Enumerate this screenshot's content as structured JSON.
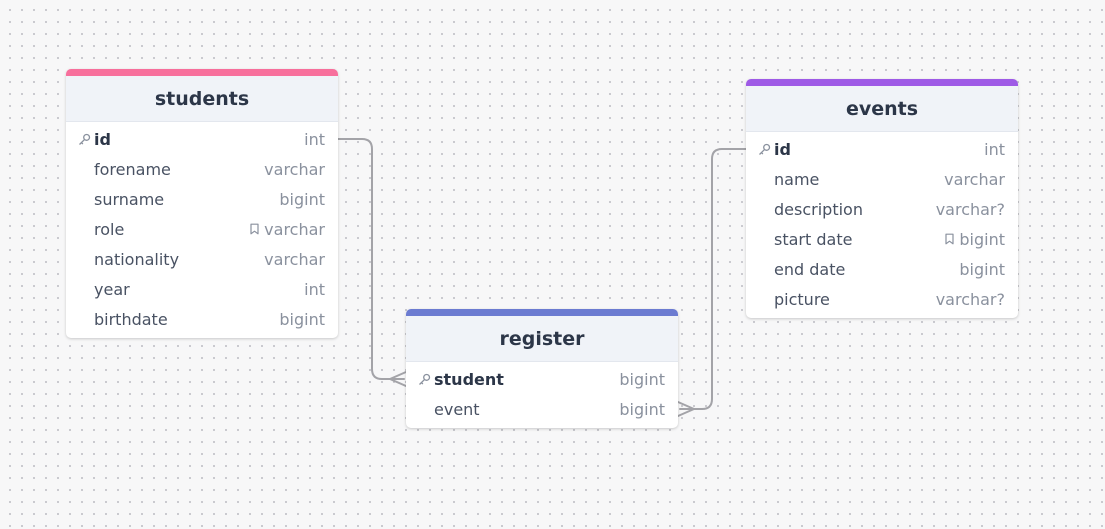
{
  "colors": {
    "students_accent": "#f76f9c",
    "events_accent": "#9e5ae6",
    "register_accent": "#6b7bd1",
    "connector": "#a3a3a8"
  },
  "tables": {
    "students": {
      "title": "students",
      "columns": [
        {
          "name": "id",
          "type": "int",
          "pk": true
        },
        {
          "name": "forename",
          "type": "varchar"
        },
        {
          "name": "surname",
          "type": "bigint"
        },
        {
          "name": "role",
          "type": "varchar",
          "note": true
        },
        {
          "name": "nationality",
          "type": "varchar"
        },
        {
          "name": "year",
          "type": "int"
        },
        {
          "name": "birthdate",
          "type": "bigint"
        }
      ]
    },
    "events": {
      "title": "events",
      "columns": [
        {
          "name": "id",
          "type": "int",
          "pk": true
        },
        {
          "name": "name",
          "type": "varchar"
        },
        {
          "name": "description",
          "type": "varchar?"
        },
        {
          "name": "start date",
          "type": "bigint",
          "note": true
        },
        {
          "name": "end date",
          "type": "bigint"
        },
        {
          "name": "picture",
          "type": "varchar?"
        }
      ]
    },
    "register": {
      "title": "register",
      "columns": [
        {
          "name": "student",
          "type": "bigint",
          "pk": true
        },
        {
          "name": "event",
          "type": "bigint"
        }
      ]
    }
  },
  "relationships": [
    {
      "from": "students.id",
      "to": "register.student",
      "to_cardinality": "many"
    },
    {
      "from": "events.id",
      "to": "register.event",
      "to_cardinality": "many"
    }
  ]
}
